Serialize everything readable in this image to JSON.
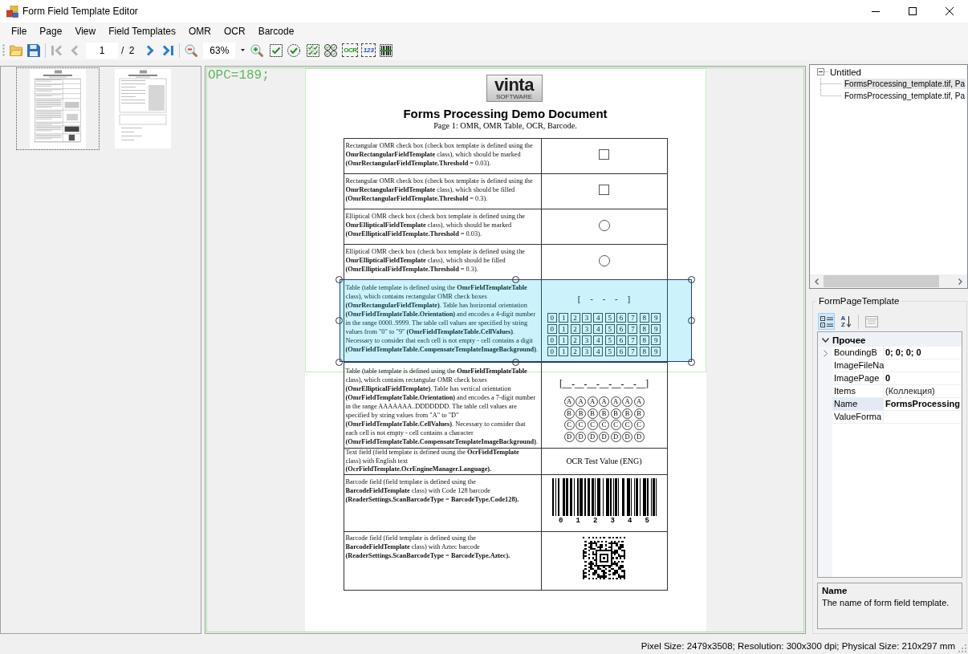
{
  "window": {
    "title": "Form Field Template Editor"
  },
  "menu": [
    "File",
    "Page",
    "View",
    "Field Templates",
    "OMR",
    "OCR",
    "Barcode"
  ],
  "toolbar": {
    "navigation": [
      {
        "kind": "first",
        "disabled": true
      },
      {
        "kind": "previous",
        "disabled": true
      },
      {
        "kind": "next",
        "disabled": false
      },
      {
        "kind": "last",
        "disabled": false
      }
    ],
    "page": "1",
    "page_count": "/ 2",
    "zoom": "63%",
    "field_tools": [
      {
        "kind": "rect_checkbox"
      },
      {
        "kind": "ellipse_checkbox"
      },
      {
        "kind": "rect_table"
      },
      {
        "kind": "ellipse_table"
      },
      {
        "kind": "ocr",
        "label": "OCR"
      },
      {
        "kind": "number",
        "label": "123"
      },
      {
        "kind": "barcode"
      }
    ]
  },
  "thumbnails": [
    {
      "selected": true
    },
    {
      "selected": false
    }
  ],
  "viewer": {
    "marker": "OPC=189;",
    "document": {
      "logo": {
        "wordmark": "vinta",
        "subtitle": "SOFTWARE"
      },
      "title": "Forms Processing Demo Document",
      "subtitle": "Page 1: OMR, OMR Table, OCR, Barcode.",
      "rows": [
        {
          "kind": "square_checkbox",
          "selected": false,
          "text": "Rectangular OMR check box (check box template is defined using the **OmrRectangularFieldTemplate** class), which should be marked **(OmrRectangularFieldTemplate.Threshold** = 0.03)."
        },
        {
          "kind": "square_checkbox",
          "selected": false,
          "text": "Rectangular OMR check box (check box template is defined using the **OmrRectangularFieldTemplate** class), which should be filled **(OmrRectangularFieldTemplate.Threshold** = 0.3)."
        },
        {
          "kind": "circle_checkbox",
          "selected": false,
          "text": "Elliptical OMR check box (check box template is defined using the **OmrEllipticalFieldTemplate** class), which should be marked **(OmrEllipticalFieldTemplate.Threshold** = 0.03)."
        },
        {
          "kind": "circle_checkbox",
          "selected": false,
          "text": "Elliptical OMR check box (check box template is defined using the **OmrEllipticalFieldTemplate** class), which should be filled **(OmrEllipticalFieldTemplate.Threshold** = 0.3)."
        },
        {
          "kind": "digit_table",
          "selected": true,
          "text": "Table (table template is defined using the **OmrFieldTemplateTable** class), which contains rectangular OMR check boxes **(OmrRectangularFieldTemplate)**. Table has horizontal orientation **(OmrFieldTemplateTable.Orientation)** and encodes a 4-digit number in the range 0000..9999. The table cell values are specified by string values from \"0\" to \"9\" **(OmrFieldTemplateTable.CellValues)**. Necessary to consider that each cell is not empty - cell contains a digit **(OmrFieldTemplateTable.CompensateTemplateImageBackground)**.",
          "mask": "[ - - - ]",
          "grid": [
            [
              "0",
              "1",
              "2",
              "3",
              "4",
              "5",
              "6",
              "7",
              "8",
              "9"
            ],
            [
              "0",
              "1",
              "2",
              "3",
              "4",
              "5",
              "6",
              "7",
              "8",
              "9"
            ],
            [
              "0",
              "1",
              "2",
              "3",
              "4",
              "5",
              "6",
              "7",
              "8",
              "9"
            ],
            [
              "0",
              "1",
              "2",
              "3",
              "4",
              "5",
              "6",
              "7",
              "8",
              "9"
            ]
          ]
        },
        {
          "kind": "letter_table",
          "selected": false,
          "text": "Table (table template is defined using the **OmrFieldTemplateTable** class), which contains rectangular OMR check boxes **(OmrEllipticalFieldTemplate)**. Table has vertical orientation **(OmrFieldTemplateTable.Orientation)** and encodes a 7-digit number in the range AAAAAAA..DDDDDDD. The table cell values are specified by string values from \"A\" to \"D\" **(OmrFieldTemplateTable.CellValues)**. Necessary to consider that each cell is not empty - cell contains a character **(OmrFieldTemplateTable.CompensateTemplateImageBackground)**.",
          "mask": "[__-__-__-__-__-__-__]",
          "grid": [
            [
              "A",
              "A",
              "A",
              "A",
              "A",
              "A",
              "A"
            ],
            [
              "B",
              "B",
              "B",
              "B",
              "B",
              "B",
              "B"
            ],
            [
              "C",
              "C",
              "C",
              "C",
              "C",
              "C",
              "C"
            ],
            [
              "D",
              "D",
              "D",
              "D",
              "D",
              "D",
              "D"
            ]
          ]
        },
        {
          "kind": "ocr_text",
          "selected": false,
          "text": "Text field (field template is defined using the **OcrFieldTemplate** class) with English text **(OcrFieldTemplate.OcrEngineManager.Language).**",
          "value": "OCR Test Value (ENG)"
        },
        {
          "kind": "linear_barcode",
          "selected": false,
          "text": "Barcode field (field template is defined using the **BarcodeFieldTemplate** class) with Code 128 barcode **(ReaderSettings.ScanBarcodeType = BarcodeType.Code128).**",
          "digits": [
            "0",
            "1",
            "2",
            "3",
            "4",
            "5"
          ]
        },
        {
          "kind": "matrix_barcode",
          "selected": false,
          "text": "Barcode field (field template is defined using the **BarcodeFieldTemplate** class) with Aztec barcode **(ReaderSettings.ScanBarcodeType = BarcodeType.Aztec).**"
        }
      ]
    }
  },
  "tree": {
    "root": {
      "label": "Untitled",
      "expanded": true,
      "children": [
        {
          "label": "FormsProcessing_template.tif, Pa",
          "selected": true
        },
        {
          "label": "FormsProcessing_template.tif, Pa",
          "selected": false
        }
      ]
    }
  },
  "properties": {
    "title": "FormPageTemplate",
    "view_modes": [
      {
        "kind": "categorized",
        "selected": true
      },
      {
        "kind": "alphabetical",
        "label": "AZ",
        "selected": false
      }
    ],
    "property_pages": {
      "disabled": true
    },
    "category": {
      "label": "Прочее",
      "expanded": true
    },
    "rows": [
      {
        "name": "BoundingB",
        "value": "0; 0; 0; 0",
        "modified": true,
        "expandable": true,
        "selected": false
      },
      {
        "name": "ImageFileNa",
        "expandable": false,
        "selected": false
      },
      {
        "name": "ImagePage",
        "value": "0",
        "modified": true,
        "expandable": false,
        "selected": false
      },
      {
        "name": "Items",
        "value": "(Коллекция)",
        "modified": false,
        "expandable": false,
        "selected": false
      },
      {
        "name": "Name",
        "value": "FormsProcessing",
        "modified": true,
        "expandable": false,
        "selected": true
      },
      {
        "name": "ValueForma",
        "expandable": false,
        "selected": false
      }
    ],
    "description": {
      "title": "Name",
      "text": "The name of form field template."
    }
  },
  "status_bar": {
    "text": "Pixel Size: 2479x3508; Resolution: 300x300 dpi; Physical Size: 210x297 mm"
  }
}
